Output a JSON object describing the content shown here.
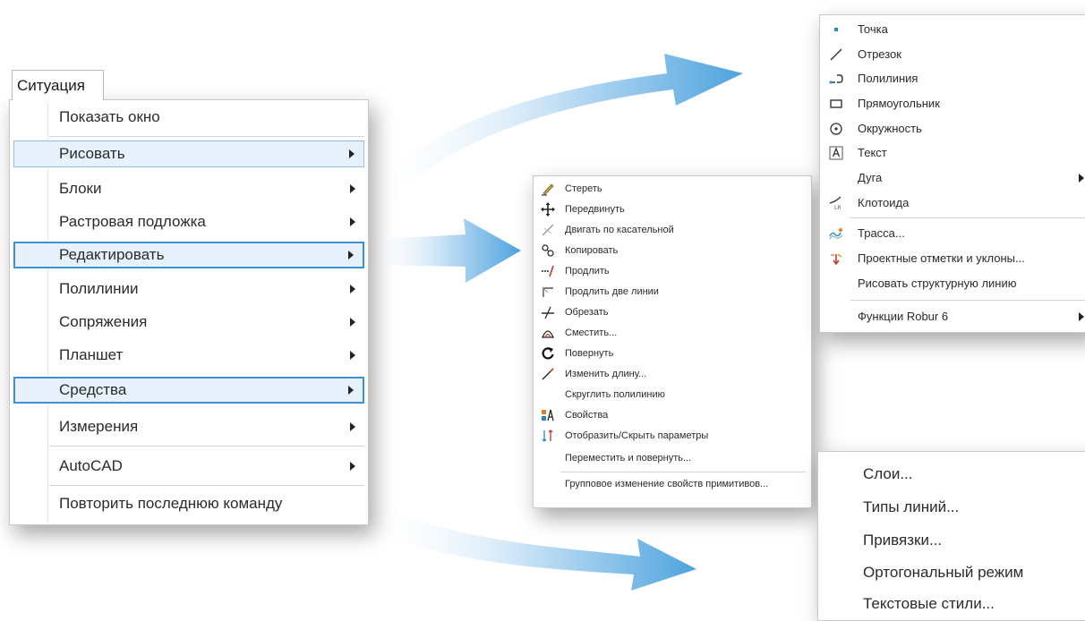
{
  "main_menu": {
    "tab_label": "Ситуация",
    "items": [
      {
        "label": "Показать окно"
      },
      {
        "label": "Рисовать"
      },
      {
        "label": "Блоки"
      },
      {
        "label": "Растровая подложка"
      },
      {
        "label": "Редактировать"
      },
      {
        "label": "Полилинии"
      },
      {
        "label": "Сопряжения"
      },
      {
        "label": "Планшет"
      },
      {
        "label": "Средства"
      },
      {
        "label": "Измерения"
      },
      {
        "label": "AutoCAD"
      },
      {
        "label": "Повторить последнюю команду"
      }
    ]
  },
  "edit_menu": {
    "items": [
      {
        "label": "Стереть",
        "icon": "eraser-icon"
      },
      {
        "label": "Передвинуть",
        "icon": "move-icon"
      },
      {
        "label": "Двигать по касательной",
        "icon": "tangent-move-icon"
      },
      {
        "label": "Копировать",
        "icon": "copy-icon"
      },
      {
        "label": "Продлить",
        "icon": "extend-icon"
      },
      {
        "label": "Продлить две линии",
        "icon": "extend-two-icon"
      },
      {
        "label": "Обрезать",
        "icon": "trim-icon"
      },
      {
        "label": "Сместить...",
        "icon": "offset-icon"
      },
      {
        "label": "Повернуть",
        "icon": "rotate-icon"
      },
      {
        "label": "Изменить длину...",
        "icon": "lengthen-icon"
      },
      {
        "label": "Скруглить полилинию",
        "icon": ""
      },
      {
        "label": "Свойства",
        "icon": "properties-icon"
      },
      {
        "label": "Отобразить/Скрыть параметры",
        "icon": "parameters-icon"
      },
      {
        "label": "Переместить и повернуть...",
        "icon": ""
      },
      {
        "label": "Групповое изменение свойств примитивов...",
        "icon": ""
      }
    ]
  },
  "draw_menu": {
    "items": [
      {
        "label": "Точка",
        "icon": "point-icon"
      },
      {
        "label": "Отрезок",
        "icon": "line-icon"
      },
      {
        "label": "Полилиния",
        "icon": "polyline-icon"
      },
      {
        "label": "Прямоугольник",
        "icon": "rectangle-icon"
      },
      {
        "label": "Окружность",
        "icon": "circle-icon"
      },
      {
        "label": "Текст",
        "icon": "text-icon"
      },
      {
        "label": "Дуга",
        "icon": ""
      },
      {
        "label": "Клотоида",
        "icon": "clothoid-icon"
      },
      {
        "label": "Трасса...",
        "icon": "route-icon"
      },
      {
        "label": "Проектные отметки и уклоны...",
        "icon": "elevations-icon"
      },
      {
        "label": "Рисовать структурную линию",
        "icon": ""
      },
      {
        "label": "Функции Robur 6",
        "icon": ""
      }
    ]
  },
  "tools_menu": {
    "items": [
      {
        "label": "Слои..."
      },
      {
        "label": "Типы линий..."
      },
      {
        "label": "Привязки..."
      },
      {
        "label": "Ортогональный режим"
      },
      {
        "label": "Текстовые стили..."
      }
    ]
  },
  "colors": {
    "highlight_bg": "#e6f1fb",
    "highlight_border": "#3f91d6",
    "arrow_fill": "#6eb3e3"
  }
}
